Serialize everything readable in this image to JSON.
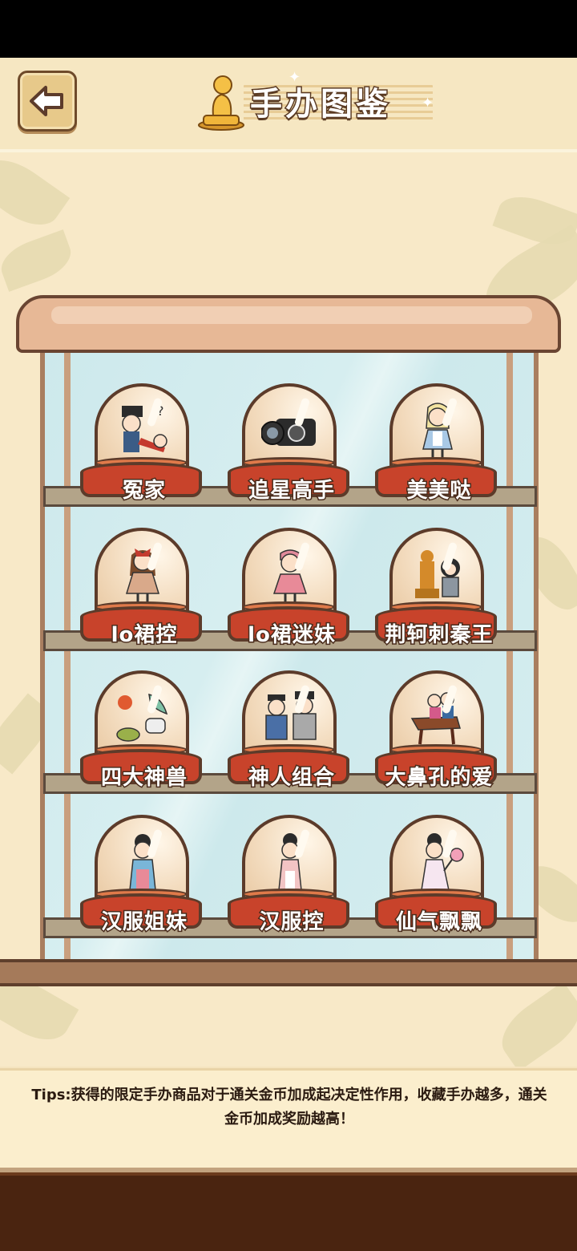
{
  "header": {
    "title": "手办图鉴",
    "back_icon": "back-arrow-icon",
    "title_icon": "golden-figurine-icon"
  },
  "colors": {
    "header_bg": "#f6e7c2",
    "pedestal": "#c8432b",
    "footer": "#4a2410"
  },
  "figures": [
    {
      "label": "冤家",
      "icon": "couple-figure-icon"
    },
    {
      "label": "追星高手",
      "icon": "camera-figure-icon"
    },
    {
      "label": "美美哒",
      "icon": "alice-figure-icon"
    },
    {
      "label": "lo裙控",
      "icon": "lolita-red-figure-icon"
    },
    {
      "label": "lo裙迷妹",
      "icon": "lolita-pink-figure-icon"
    },
    {
      "label": "荆轲刺秦王",
      "icon": "assassin-figure-icon"
    },
    {
      "label": "四大神兽",
      "icon": "four-beasts-figure-icon"
    },
    {
      "label": "神人组合",
      "icon": "two-officials-figure-icon"
    },
    {
      "label": "大鼻孔的爱",
      "icon": "horse-riders-figure-icon"
    },
    {
      "label": "汉服姐妹",
      "icon": "hanfu-blue-figure-icon"
    },
    {
      "label": "汉服控",
      "icon": "hanfu-pink-figure-icon"
    },
    {
      "label": "仙气飘飘",
      "icon": "fairy-figure-icon"
    }
  ],
  "tips": {
    "text": "Tips:获得的限定手办商品对于通关金币加成起决定性作用，收藏手办越多，通关金币加成奖励越高！"
  }
}
